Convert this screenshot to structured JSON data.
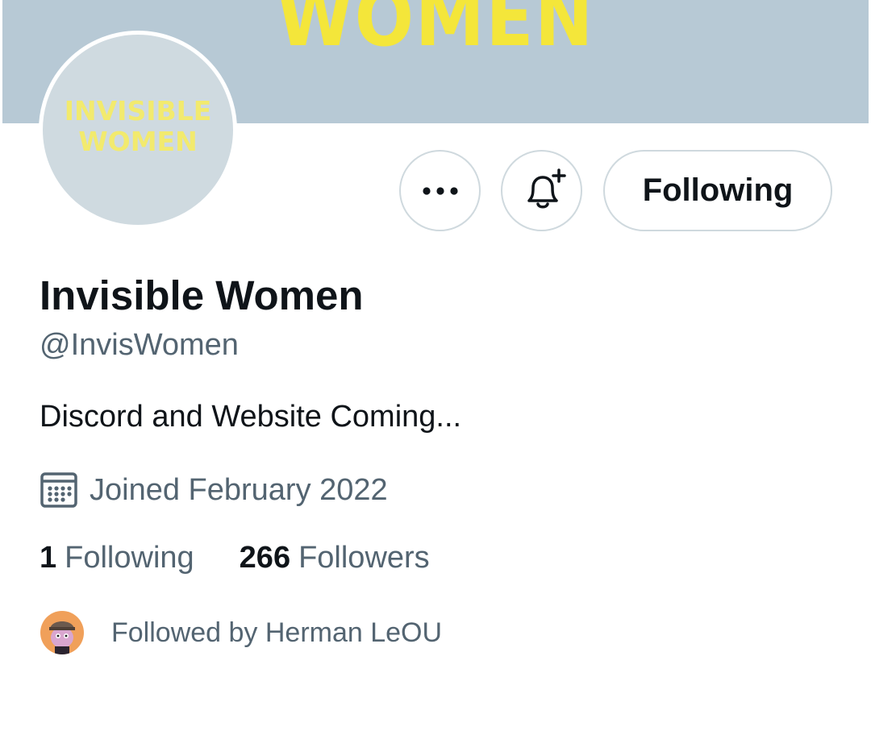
{
  "banner": {
    "text": "WOMEN"
  },
  "avatar": {
    "line1": "INVISIBLE",
    "line2": "WOMEN"
  },
  "actions": {
    "more_icon": "more-horizontal-icon",
    "bell_icon": "bell-plus-icon",
    "follow_label": "Following"
  },
  "profile": {
    "name": "Invisible Women",
    "handle": "@InvisWomen",
    "bio": "Discord and Website Coming...",
    "joined": "Joined February 2022"
  },
  "stats": {
    "following_count": "1",
    "following_label": "Following",
    "followers_count": "266",
    "followers_label": "Followers"
  },
  "followed_by": {
    "text": "Followed by Herman LeOU"
  },
  "colors": {
    "banner": "#b7c9d5",
    "avatar_bg": "#cfdae0",
    "logo_yellow": "#f4e63a",
    "text_primary": "#0f1419",
    "text_secondary": "#536471",
    "button_border": "#cfd9de"
  }
}
